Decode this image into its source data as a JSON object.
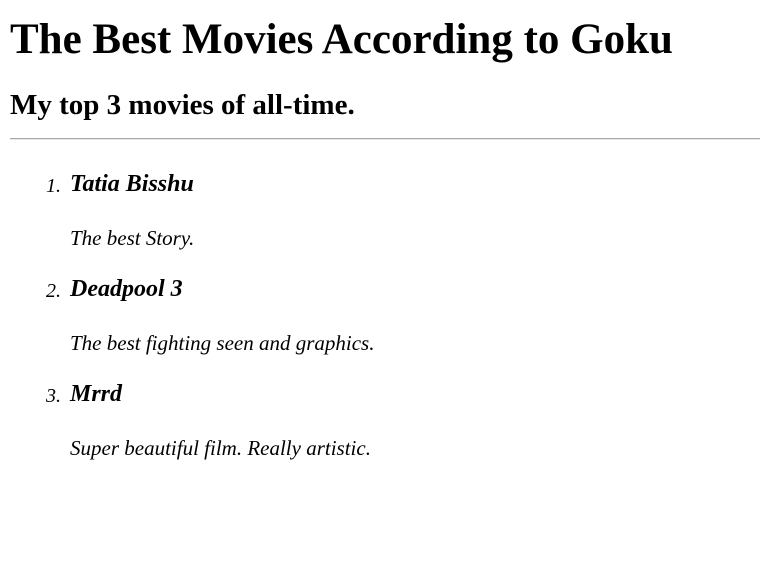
{
  "page": {
    "title": "The Best Movies According to Goku",
    "subtitle": "My top 3 movies of all-time."
  },
  "movies": [
    {
      "number": "1.",
      "title": "Tatia Bisshu",
      "description": "The best Story."
    },
    {
      "number": "2.",
      "title": "Deadpool 3",
      "description": "The best fighting seen and graphics."
    },
    {
      "number": "3.",
      "title": "Mrrd",
      "description": "Super beautiful film. Really artistic."
    }
  ]
}
